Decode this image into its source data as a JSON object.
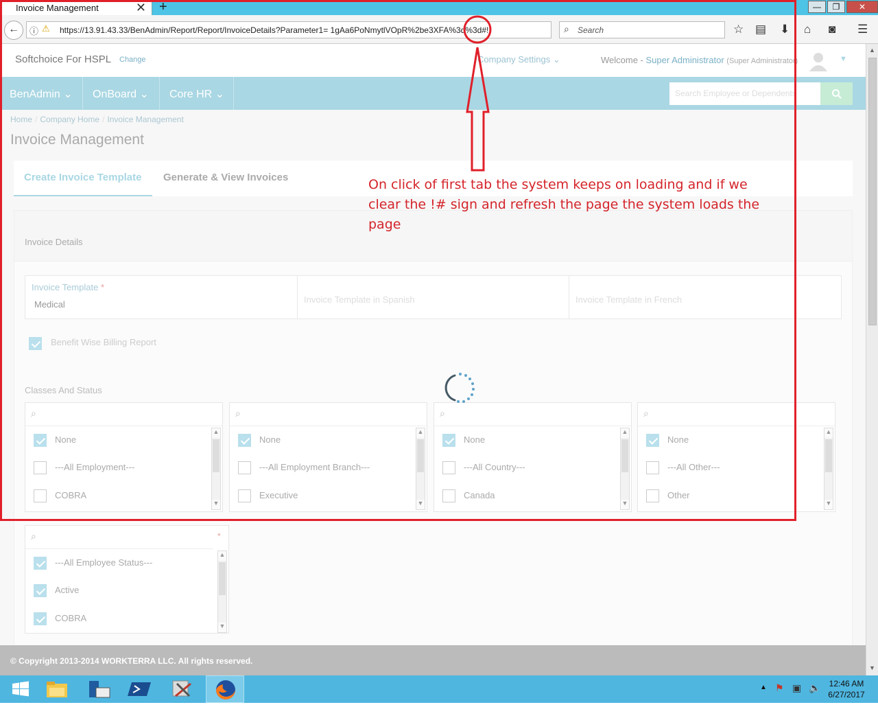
{
  "browser": {
    "tab_title": "Invoice Management",
    "new_tab": "+",
    "tab_close": "✕",
    "url": "https://13.91.43.33/BenAdmin/Report/Report/InvoiceDetails?Parameter1= 1gAa6PoNmytlVOpR%2be3XFA%3d%3d#!",
    "search_placeholder": "Search",
    "window_buttons": [
      "—",
      "❐",
      "✕"
    ]
  },
  "header": {
    "brand": "Softchoice For HSPL",
    "change": "Change",
    "company_settings": "Company Settings",
    "welcome": "Welcome - ",
    "user_name": "Super Administrator",
    "user_role": "(Super Administrator)"
  },
  "menu": {
    "items": [
      {
        "label": "BenAdmin"
      },
      {
        "label": "OnBoard"
      },
      {
        "label": "Core HR"
      }
    ],
    "search_placeholder": "Search Employee or Dependents"
  },
  "breadcrumb": [
    "Home",
    "Company Home",
    "Invoice Management"
  ],
  "page_title": "Invoice Management",
  "tabs": [
    {
      "label": "Create Invoice Template",
      "active": true
    },
    {
      "label": "Generate & View Invoices",
      "active": false
    }
  ],
  "invoice_details": {
    "title": "Invoice Details",
    "template_label": "Invoice Template",
    "required_mark": "*",
    "template_value": "Medical",
    "spanish_placeholder": "Invoice Template in Spanish",
    "french_placeholder": "Invoice Template in French",
    "benefit_billing_label": "Benefit Wise Billing Report",
    "benefit_billing_checked": true,
    "classes_title": "Classes And Status"
  },
  "class_lists": [
    {
      "items": [
        {
          "label": "None",
          "checked": true
        },
        {
          "label": "---All Employment---",
          "checked": false
        },
        {
          "label": "COBRA",
          "checked": false
        }
      ]
    },
    {
      "items": [
        {
          "label": "None",
          "checked": true
        },
        {
          "label": "---All Employment Branch---",
          "checked": false
        },
        {
          "label": "Executive",
          "checked": false
        }
      ]
    },
    {
      "items": [
        {
          "label": "None",
          "checked": true
        },
        {
          "label": "---All Country---",
          "checked": false
        },
        {
          "label": "Canada",
          "checked": false
        }
      ]
    },
    {
      "items": [
        {
          "label": "None",
          "checked": true
        },
        {
          "label": "---All Other---",
          "checked": false
        },
        {
          "label": "Other",
          "checked": false
        }
      ]
    }
  ],
  "status_list": {
    "required_mark": "*",
    "items": [
      {
        "label": "---All Employee Status---",
        "checked": true
      },
      {
        "label": "Active",
        "checked": true
      },
      {
        "label": "COBRA",
        "checked": true
      }
    ]
  },
  "footer": "© Copyright 2013-2014 WORKTERRA LLC. All rights reserved.",
  "annotation": "On click of first tab the system keeps on loading and if we clear the !# sign and refresh the page the system loads the page",
  "clock": {
    "time": "12:46 AM",
    "date": "6/27/2017"
  },
  "colors": {
    "annotation": "#e0202a",
    "menubar": "#a9d7e3",
    "taskbar": "#4fb6e0"
  }
}
